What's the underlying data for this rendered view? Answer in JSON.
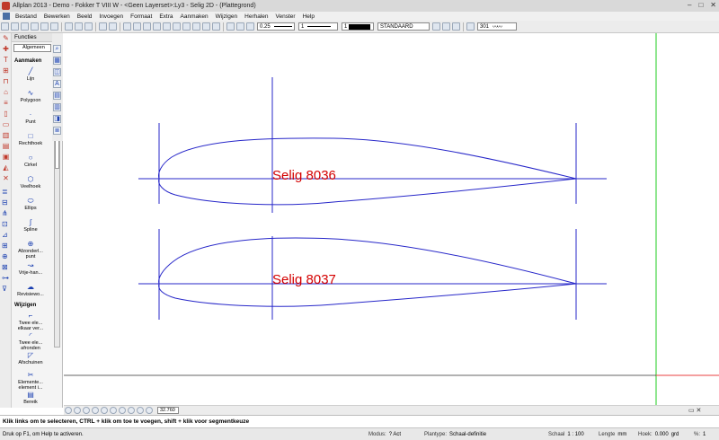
{
  "window": {
    "title": "Allplan 2013 - Demo - Fokker T VIII W - <Geen Layerset>:Ly3 - Selig 2D - (Plattegrond)"
  },
  "menu": {
    "items": [
      "Bestand",
      "Bewerken",
      "Beeld",
      "Invoegen",
      "Formaat",
      "Extra",
      "Aanmaken",
      "Wijzigen",
      "Herhalen",
      "Venster",
      "Help"
    ]
  },
  "toolbar": {
    "pen_thickness": "0.25",
    "line_type": "1",
    "color_number": "1",
    "layer_name": "STANDAARD",
    "hatch_number": "301"
  },
  "palette": {
    "header": "Functies",
    "category": "Algemeen",
    "section_create": "Aanmaken",
    "section_modify": "Wijzigen",
    "create_tools": [
      {
        "label": "Lijn",
        "icon": "line-icon",
        "glyph": "╱"
      },
      {
        "label": "Polygoon",
        "icon": "polygon-icon",
        "glyph": "∿"
      },
      {
        "label": "Punt",
        "icon": "point-icon",
        "glyph": "·"
      },
      {
        "label": "Rechthoek",
        "icon": "rectangle-icon",
        "glyph": "□"
      },
      {
        "label": "Cirkel",
        "icon": "circle-icon",
        "glyph": "○"
      },
      {
        "label": "Veelhoek",
        "icon": "polygon-shape-icon",
        "glyph": "⬡"
      },
      {
        "label": "Ellips",
        "icon": "ellipse-icon",
        "glyph": "⬭"
      },
      {
        "label": "Spline",
        "icon": "spline-icon",
        "glyph": "∫"
      },
      {
        "label": "Afzonderl... punt",
        "icon": "single-point-icon",
        "glyph": "⊕"
      },
      {
        "label": "Vrije-han...",
        "icon": "freehand-icon",
        "glyph": "↝"
      },
      {
        "label": "Revisiewo...",
        "icon": "revision-cloud-icon",
        "glyph": "☁"
      }
    ],
    "modify_tools": [
      {
        "label": "Twee ele... elkaar ver...",
        "icon": "connect-elements-icon",
        "glyph": "⌐"
      },
      {
        "label": "Twee ele... afronden",
        "icon": "fillet-icon",
        "glyph": "◜"
      },
      {
        "label": "Afschuinen",
        "icon": "chamfer-icon",
        "glyph": "◸"
      },
      {
        "label": "Elemente... element i...",
        "icon": "modify-elements-icon",
        "glyph": "✂"
      },
      {
        "label": "Bereik",
        "icon": "range-icon",
        "glyph": "▤"
      }
    ]
  },
  "drawing": {
    "labels": [
      "Selig 8036",
      "Selig 8037"
    ],
    "label_color": "#d40000",
    "line_color": "#2727c9",
    "axis_vertical_color": "#22cc22",
    "axis_horizontal_color": "#e84141"
  },
  "bottom_toolbar": {
    "zoom_value": "32.760"
  },
  "prompt": "Klik links om te selecteren, CTRL + klik om toe te voegen, shift + klik voor segmentkeuze",
  "status": {
    "hint": "Druk op F1, om Help te activeren.",
    "mode_label": "Modus:",
    "mode_value": "? Act",
    "plantype_label": "Plantype:",
    "plantype_value": "Schaal-definitie",
    "scale_label": "Schaal",
    "scale_value": "1 : 100",
    "length_label": "Lengte",
    "length_value": "mm",
    "angle_label": "Hoek:",
    "angle_value": "0.000",
    "angle_unit": "grd",
    "percent_label": "%:",
    "percent_value": "1"
  }
}
